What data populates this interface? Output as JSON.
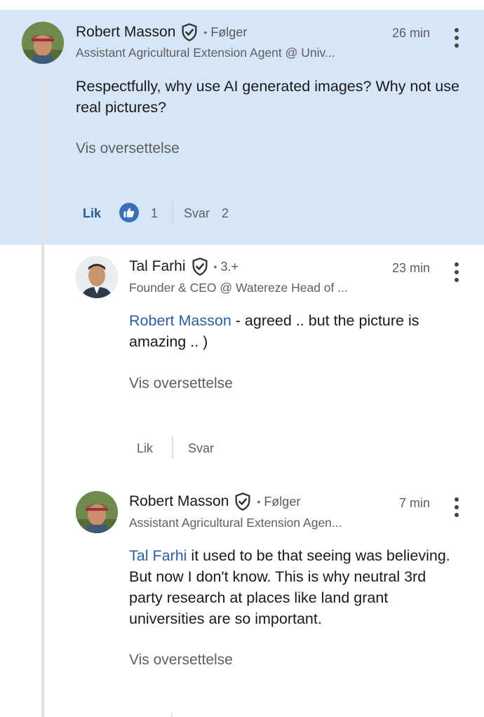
{
  "comments": [
    {
      "author": "Robert Masson",
      "badge_icon": "shield-check-icon",
      "relation": "Følger",
      "subtitle": "Assistant Agricultural Extension Agent @ Univ...",
      "time": "26 min",
      "text": "Respectfully, why use AI generated images? Why not use real pictures?",
      "translate": "Vis oversettelse",
      "like_label": "Lik",
      "like_count": "1",
      "reply_label": "Svar",
      "reply_count": "2"
    },
    {
      "author": "Tal Farhi",
      "badge_icon": "shield-check-icon",
      "relation": "3.+",
      "subtitle": "Founder & CEO @ Watereze Head of ...",
      "time": "23 min",
      "mention": "Robert Masson",
      "text": " - agreed .. but the picture is amazing .. )",
      "translate": "Vis oversettelse",
      "like_label": "Lik",
      "reply_label": "Svar"
    },
    {
      "author": "Robert Masson",
      "badge_icon": "shield-check-icon",
      "relation": "Følger",
      "subtitle": "Assistant Agricultural Extension Agen...",
      "time": "7 min",
      "mention": "Tal Farhi",
      "text": " it used to be that seeing was believing. But now I don't know. This is why neutral 3rd party research at places like land grant universities are so important.",
      "translate": "Vis oversettelse"
    }
  ],
  "colors": {
    "highlight": "#d6e6f8",
    "mention": "#2c5f9e",
    "like_blue": "#3b6fb6"
  }
}
